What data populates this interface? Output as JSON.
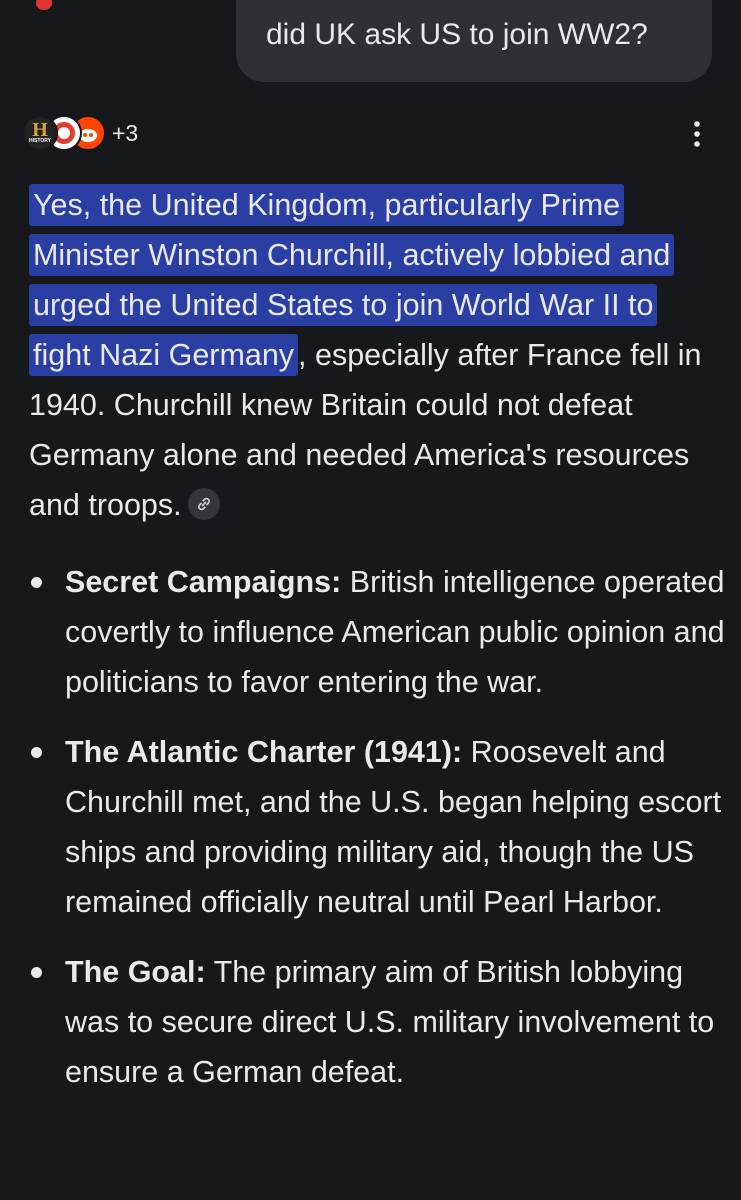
{
  "user_query": "did UK ask US to join WW2?",
  "sources": {
    "icons": [
      "history-logo-icon",
      "red-ring-icon",
      "reddit-icon"
    ],
    "history_letter": "H",
    "history_sub": "HISTORY",
    "extra_count": "+3"
  },
  "answer": {
    "highlighted": "Yes, the United Kingdom, particularly Prime Minister Winston Churchill, actively lobbied and urged the United States to join World War II to fight Nazi Germany",
    "rest": ", especially after France fell in 1940. Churchill knew Britain could not defeat Germany alone and needed America's resources and troops."
  },
  "bullets": [
    {
      "title": "Secret Campaigns:",
      "text": " British intelligence operated covertly to influence American public opinion and politicians to favor entering the war."
    },
    {
      "title": "The Atlantic Charter (1941):",
      "text": " Roosevelt and Churchill met, and the U.S. began helping escort ships and providing military aid, though the US remained officially neutral until Pearl Harbor."
    },
    {
      "title": "The Goal:",
      "text": " The primary aim of British lobbying was to secure direct U.S. military involvement to ensure a German defeat."
    }
  ],
  "colors": {
    "background": "#17181c",
    "bubble": "#2f3035",
    "highlight": "#2b3ea3",
    "text": "#e8e9ed"
  }
}
